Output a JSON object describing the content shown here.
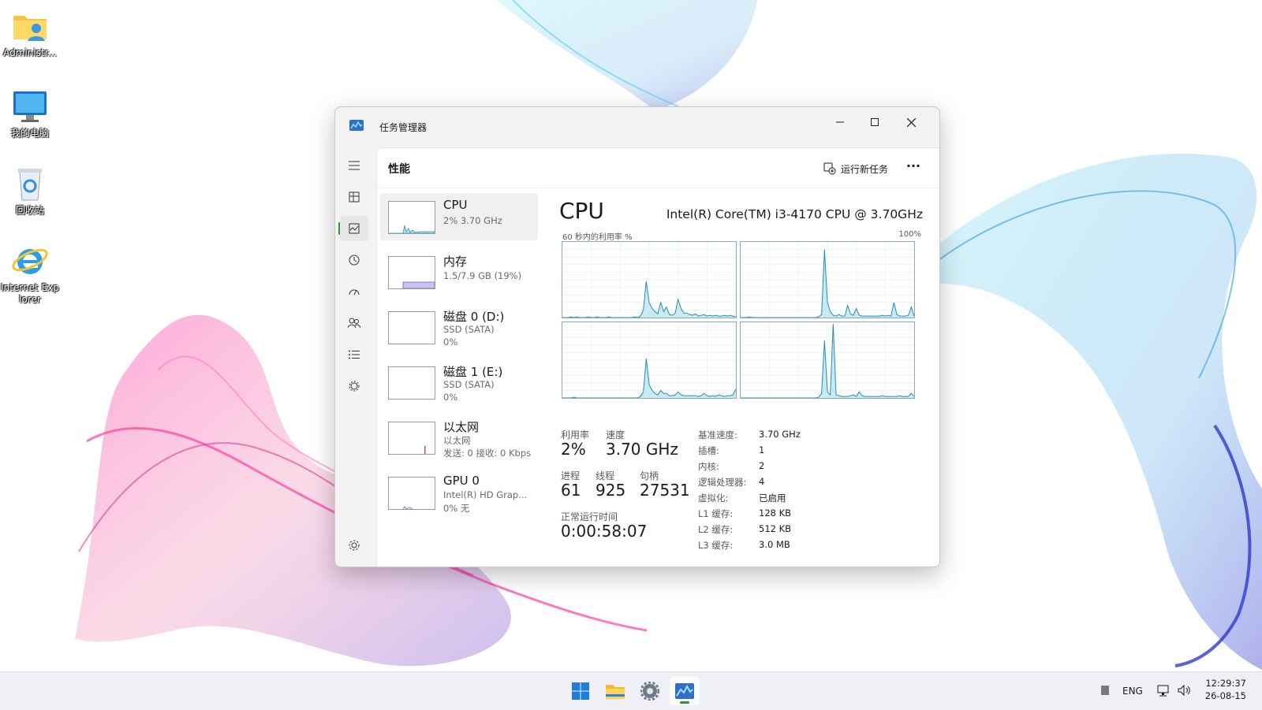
{
  "desktop": {
    "icons": [
      {
        "label": "Administr...",
        "icon": "user-folder-icon"
      },
      {
        "label": "我的电脑",
        "icon": "computer-monitor-icon"
      },
      {
        "label": "回收站",
        "icon": "recycle-bin-icon"
      },
      {
        "label": "Internet Explorer",
        "icon": "internet-explorer-icon"
      }
    ]
  },
  "window": {
    "title": "任务管理器",
    "controls": {
      "minimize": "minimize-icon",
      "maximize": "maximize-icon",
      "close": "close-icon"
    },
    "rail": [
      "menu-icon",
      "processes-icon",
      "performance-icon",
      "app-history-icon",
      "startup-icon",
      "users-icon",
      "details-icon",
      "services-icon",
      "settings-icon"
    ],
    "header": {
      "page_title": "性能",
      "run_task_label": "运行新任务",
      "more_label": "···"
    },
    "devices": [
      {
        "name": "CPU",
        "sub1": "2% 3.70 GHz",
        "sub2": ""
      },
      {
        "name": "内存",
        "sub1": "1.5/7.9 GB (19%)",
        "sub2": ""
      },
      {
        "name": "磁盘 0 (D:)",
        "sub1": "SSD (SATA)",
        "sub2": "0%"
      },
      {
        "name": "磁盘 1 (E:)",
        "sub1": "SSD (SATA)",
        "sub2": "0%"
      },
      {
        "name": "以太网",
        "sub1": "以太网",
        "sub2": "发送: 0 接收: 0 Kbps"
      },
      {
        "name": "GPU 0",
        "sub1": "Intel(R) HD Grap...",
        "sub2": "0% 无"
      }
    ],
    "cpu": {
      "title": "CPU",
      "model": "Intel(R) Core(TM) i3-4170 CPU @ 3.70GHz",
      "graph_caption": "60 秒内的利用率 %",
      "graph_max": "100%",
      "stats": {
        "util_label": "利用率",
        "util_value": "2%",
        "speed_label": "速度",
        "speed_value": "3.70 GHz",
        "proc_label": "进程",
        "proc_value": "61",
        "thread_label": "线程",
        "thread_value": "925",
        "handle_label": "句柄",
        "handle_value": "27531",
        "uptime_label": "正常运行时间",
        "uptime_value": "0:00:58:07"
      },
      "specs": [
        {
          "k": "基准速度:",
          "v": "3.70 GHz"
        },
        {
          "k": "插槽:",
          "v": "1"
        },
        {
          "k": "内核:",
          "v": "2"
        },
        {
          "k": "逻辑处理器:",
          "v": "4"
        },
        {
          "k": "虚拟化:",
          "v": "已启用"
        },
        {
          "k": "L1 缓存:",
          "v": "128 KB"
        },
        {
          "k": "L2 缓存:",
          "v": "512 KB"
        },
        {
          "k": "L3 缓存:",
          "v": "3.0 MB"
        }
      ],
      "core_utilization": [
        [
          0,
          0,
          0,
          1,
          0,
          1,
          0,
          0,
          0,
          1,
          0,
          0,
          1,
          0,
          0,
          0,
          1,
          0,
          0,
          0,
          0,
          0,
          0,
          0,
          0,
          1,
          0,
          2,
          10,
          48,
          20,
          12,
          8,
          5,
          20,
          8,
          14,
          4,
          3,
          6,
          24,
          12,
          6,
          6,
          4,
          3,
          5,
          2,
          3,
          4,
          2,
          3,
          2,
          3,
          2,
          2,
          3,
          2,
          3,
          2,
          1
        ],
        [
          0,
          0,
          0,
          1,
          0,
          0,
          0,
          0,
          0,
          0,
          0,
          0,
          0,
          0,
          0,
          0,
          0,
          0,
          0,
          0,
          0,
          0,
          0,
          0,
          0,
          0,
          0,
          1,
          4,
          90,
          20,
          8,
          3,
          2,
          4,
          2,
          2,
          16,
          5,
          3,
          12,
          3,
          2,
          2,
          2,
          2,
          2,
          2,
          2,
          3,
          2,
          3,
          2,
          20,
          4,
          2,
          2,
          2,
          3,
          14,
          2
        ],
        [
          0,
          0,
          0,
          0,
          1,
          0,
          0,
          0,
          0,
          0,
          0,
          0,
          0,
          0,
          0,
          0,
          0,
          0,
          0,
          0,
          0,
          0,
          0,
          0,
          0,
          0,
          0,
          2,
          8,
          52,
          18,
          10,
          6,
          4,
          10,
          6,
          6,
          3,
          3,
          4,
          8,
          4,
          3,
          3,
          3,
          3,
          3,
          2,
          3,
          6,
          3,
          2,
          3,
          2,
          4,
          3,
          2,
          3,
          3,
          4,
          12
        ],
        [
          0,
          0,
          0,
          0,
          0,
          0,
          0,
          0,
          0,
          0,
          0,
          0,
          0,
          0,
          0,
          0,
          0,
          0,
          0,
          0,
          0,
          0,
          0,
          0,
          0,
          0,
          0,
          1,
          6,
          76,
          8,
          4,
          98,
          4,
          3,
          2,
          2,
          2,
          3,
          4,
          2,
          8,
          3,
          2,
          2,
          2,
          2,
          2,
          2,
          3,
          2,
          2,
          2,
          2,
          2,
          3,
          2,
          2,
          2,
          6,
          2
        ]
      ]
    }
  },
  "taskbar": {
    "apps": [
      "start-icon",
      "file-explorer-icon",
      "settings-gear-icon",
      "task-manager-icon"
    ],
    "tray": {
      "lang": "ENG",
      "time": "12:29:37",
      "date": "26-08-15"
    }
  }
}
